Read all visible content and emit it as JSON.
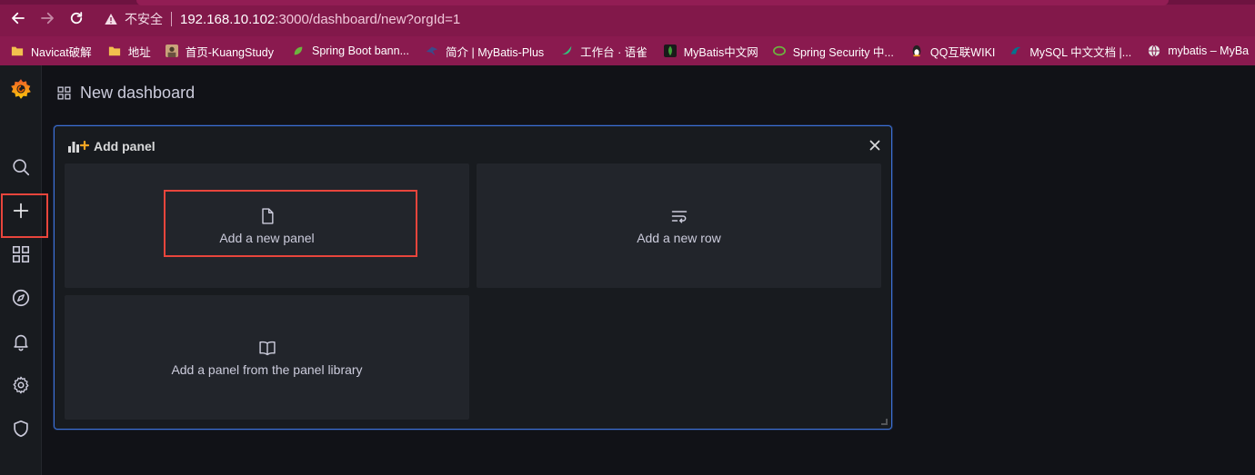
{
  "browser": {
    "security_label": "不安全",
    "url_host": "192.168.10.102",
    "url_path": ":3000/dashboard/new?orgId=1",
    "icons": [
      "back-arrow-icon",
      "forward-arrow-icon",
      "reload-icon",
      "warning-icon"
    ],
    "bookmarks": [
      {
        "label": "Navicat破解",
        "icon": "folder-icon",
        "color": "#f2c14e"
      },
      {
        "label": "地址",
        "icon": "folder-icon",
        "color": "#f2c14e"
      },
      {
        "label": "首页-KuangStudy",
        "icon": "avatar-icon",
        "color": "#c9a27a"
      },
      {
        "label": "Spring Boot bann...",
        "icon": "leaf-icon",
        "color": "#6db33f"
      },
      {
        "label": "简介 | MyBatis-Plus",
        "icon": "bird-icon",
        "color": "#3b4a8a"
      },
      {
        "label": "工作台 · 语雀",
        "icon": "yuque-icon",
        "color": "#31c27c"
      },
      {
        "label": "MyBatis中文网",
        "icon": "mongo-leaf-icon",
        "color": "#3fa037"
      },
      {
        "label": "Spring Security 中...",
        "icon": "spring-icon",
        "color": "#6db33f"
      },
      {
        "label": "QQ互联WIKI",
        "icon": "penguin-icon",
        "color": "#222222"
      },
      {
        "label": "MySQL 中文文档 |...",
        "icon": "dolphin-icon",
        "color": "#00758f"
      },
      {
        "label": "mybatis – MyBa",
        "icon": "globe-icon",
        "color": "#e6e6e6"
      }
    ]
  },
  "sidebar": {
    "items": [
      {
        "name": "grafana-logo",
        "icon": "grafana-logo-icon"
      },
      {
        "name": "search",
        "icon": "search-icon"
      },
      {
        "name": "create",
        "icon": "plus-icon"
      },
      {
        "name": "dashboards",
        "icon": "dashboards-grid-icon"
      },
      {
        "name": "explore",
        "icon": "compass-icon"
      },
      {
        "name": "alerting",
        "icon": "bell-icon"
      },
      {
        "name": "configuration",
        "icon": "gear-icon"
      },
      {
        "name": "server-admin",
        "icon": "shield-icon"
      }
    ]
  },
  "header": {
    "title": "New dashboard",
    "icon": "dashboard-grid-icon"
  },
  "panel": {
    "title": "Add panel",
    "icon": "add-panel-icon",
    "tiles": [
      {
        "label": "Add a new panel",
        "icon": "file-icon"
      },
      {
        "label": "Add a new row",
        "icon": "row-wrap-icon"
      },
      {
        "label": "Add a panel from the panel library",
        "icon": "book-icon"
      }
    ]
  },
  "colors": {
    "accent_border": "#3d71d9",
    "highlight": "#e8453c",
    "brand_logo": "#f46800",
    "chrome": "#82184a"
  }
}
